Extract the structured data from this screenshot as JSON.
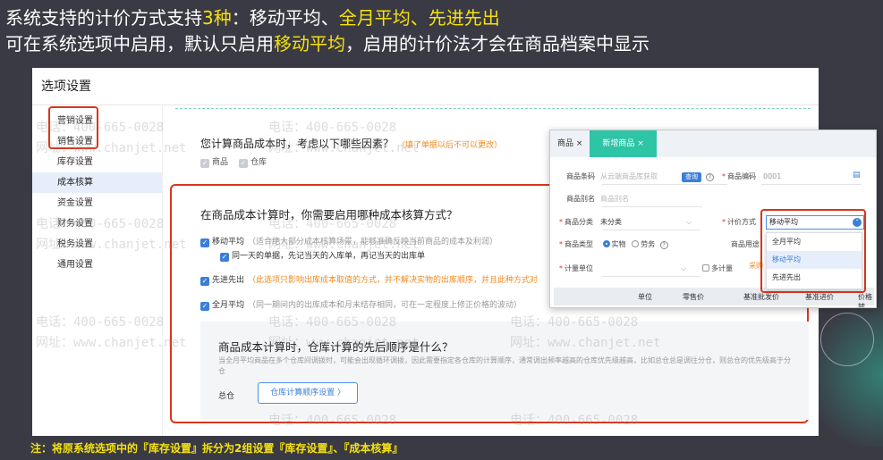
{
  "headline": {
    "line1": [
      {
        "text": "系统支持的计价方式支持",
        "hl": false
      },
      {
        "text": "3种",
        "hl": true
      },
      {
        "text": "：移动平均、",
        "hl": false
      },
      {
        "text": "全月平均、先进先出",
        "hl": true
      }
    ],
    "line2": [
      {
        "text": "可在系统选项中启用，默认只启用",
        "hl": false
      },
      {
        "text": "移动平均",
        "hl": true
      },
      {
        "text": "，启用的计价法才会在商品档案中显示",
        "hl": false
      }
    ]
  },
  "window": {
    "title": "选项设置",
    "sidebar": [
      "营销设置",
      "销售设置",
      "库存设置",
      "成本核算",
      "资金设置",
      "财务设置",
      "税务设置",
      "通用设置"
    ],
    "active_index": 3
  },
  "section1": {
    "question": "您计算商品成本时，考虑以下哪些因素？",
    "note": "（填了单据以后不可以更改）",
    "factors": [
      "商品",
      "仓库"
    ]
  },
  "section2": {
    "question": "在商品成本计算时，你需要启用哪种成本核算方式？",
    "options": [
      {
        "label": "移动平均",
        "note": "（适合绝大部分成本核算场景，能够准确反映当前商品的成本及利润）",
        "checked": true
      },
      {
        "label": "同一天的单据，先记当天的入库单，再记当天的出库单",
        "note": "",
        "checked": true
      },
      {
        "label": "先进先出",
        "note": "（此选项只影响出库成本取值的方式，并不解决实物的出库顺序，并且此种方式对",
        "checked": true
      },
      {
        "label": "全月平均",
        "note": "（同一期间内的出库成本和月末结存相同，可在一定程度上修正价格的波动）",
        "checked": true
      }
    ]
  },
  "subpanel": {
    "title": "商品成本计算时，仓库计算的先后顺序是什么？",
    "desc": "当全月平均商品在多个仓库间调拨时，可能会出现循环调拨，因此需要指定各仓库的计算顺序，通常调出频率越高的仓库优先级越高，比如总仓总是调往分仓，则总仓的优先级高于分仓",
    "label": "总仓",
    "button": "仓库计算顺序设置 〉"
  },
  "popup": {
    "tabs": [
      "商品 ×",
      "新增商品 ×"
    ],
    "barcode_label": "商品条码",
    "barcode_ph": "从云端商品库获取",
    "query": "查询",
    "code_label": "商品编码",
    "code_val": "0001",
    "alias_label": "商品别名",
    "alias_ph": "商品别名",
    "category_label": "商品分类",
    "category_val": "未分类",
    "pricing_label": "计价方式",
    "type_label": "商品类型",
    "type_options": [
      "实物",
      "劳务"
    ],
    "usage_label": "商品用途",
    "usage_val": "采购",
    "unit_label": "计量单位",
    "multi_unit": "多计量",
    "headers": [
      "单位",
      "零售价",
      "基准批发价",
      "基准进价",
      "价格转"
    ],
    "dropdown_value": "移动平均",
    "dropdown_options": [
      "全月平均",
      "移动平均",
      "先进先出"
    ],
    "dropdown_selected": 1
  },
  "footnote": "注：将原系统选项中的『库存设置』拆分为2组设置『库存设置』、『成本核算』",
  "watermark": {
    "phone": "电话：400-665-0028",
    "site": "网址：www.chanjet.net"
  }
}
